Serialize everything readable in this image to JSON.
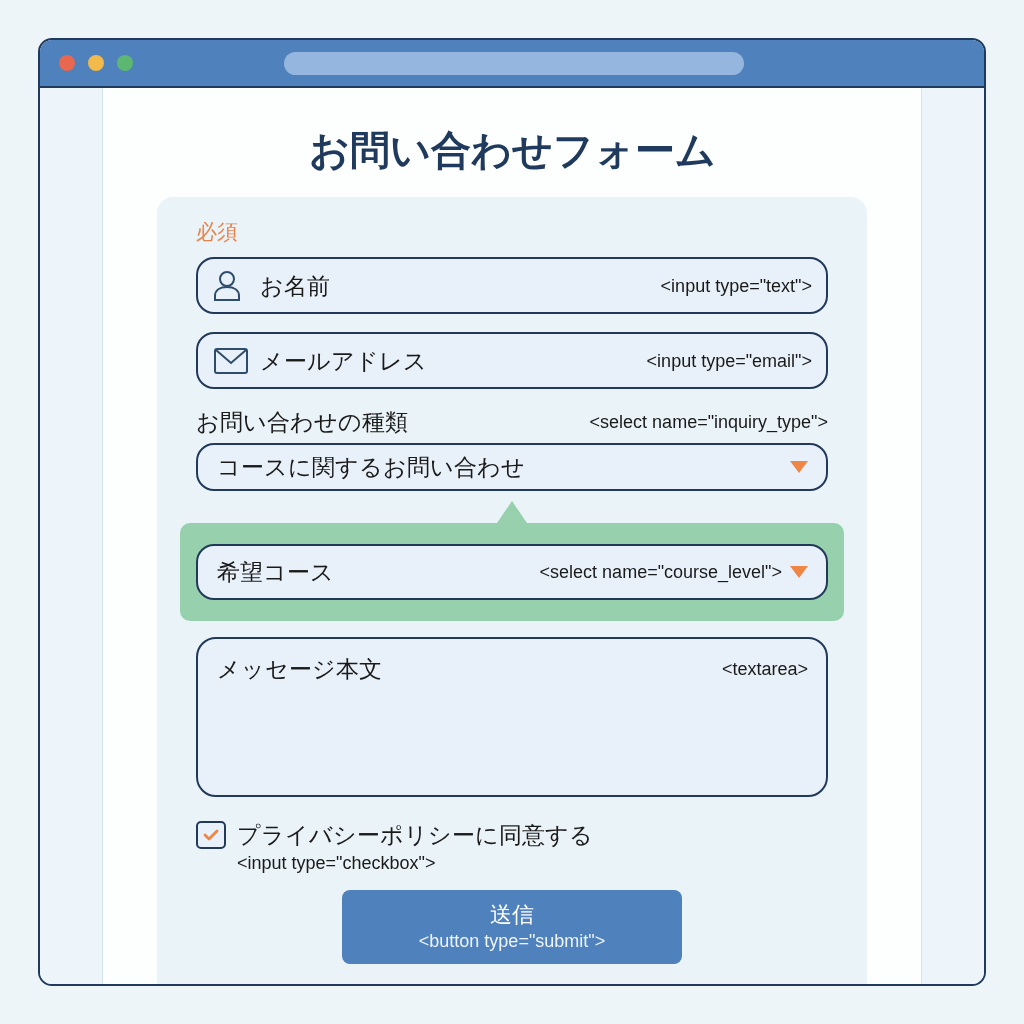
{
  "page": {
    "title": "お問い合わせフォーム"
  },
  "form": {
    "required_label": "必須",
    "fields": [
      {
        "kind": "text",
        "label": "お名前",
        "tag": "<input type=\"text\">"
      },
      {
        "kind": "email",
        "label": "メールアドレス",
        "tag": "<input type=\"email\">"
      },
      {
        "kind": "select",
        "label": "お問い合わせの種類",
        "tag": "<select name=\"inquiry_type\">",
        "value": "コースに関するお問い合わせ",
        "highlighted": false
      },
      {
        "kind": "select",
        "label": "希望コース",
        "tag": "<select name=\"course_level\">",
        "highlighted": true
      },
      {
        "kind": "textarea",
        "label": "メッセージ本文",
        "tag": "<textarea>"
      }
    ],
    "consent": {
      "label": "プライバシーポリシーに同意する",
      "tag": "<input type=\"checkbox\">",
      "checked": true
    },
    "submit": {
      "label": "送信",
      "tag": "<button type=\"submit\">"
    }
  }
}
